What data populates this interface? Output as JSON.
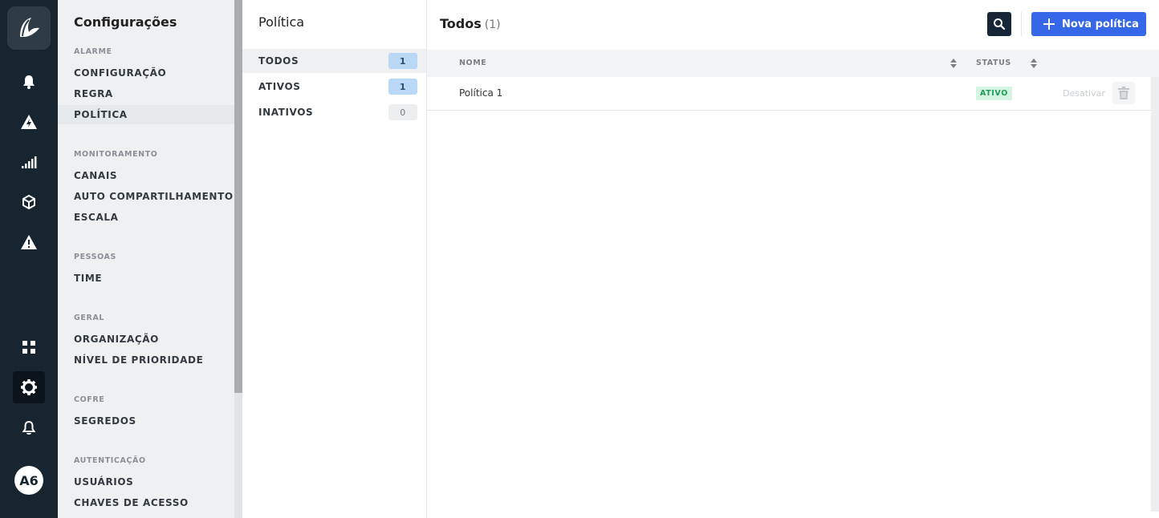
{
  "rail": {
    "avatar_initials": "A6",
    "icons": [
      "logo-icon",
      "bell-icon",
      "incident-bolt-icon",
      "signal-bars-icon",
      "cube-icon",
      "warning-icon",
      "apps-grid-icon",
      "gear-icon",
      "notification-bell-icon"
    ]
  },
  "settings": {
    "title": "Configurações",
    "sections": [
      {
        "label": "ALARME",
        "items": [
          "CONFIGURAÇÃO",
          "REGRA",
          "POLÍTICA"
        ]
      },
      {
        "label": "MONITORAMENTO",
        "items": [
          "CANAIS",
          "AUTO COMPARTILHAMENTO",
          "ESCALA"
        ]
      },
      {
        "label": "PESSOAS",
        "items": [
          "TIME"
        ]
      },
      {
        "label": "GERAL",
        "items": [
          "ORGANIZAÇÃO",
          "NÍVEL DE PRIORIDADE"
        ]
      },
      {
        "label": "COFRE",
        "items": [
          "SEGREDOS"
        ]
      },
      {
        "label": "AUTENTICAÇÃO",
        "items": [
          "USUÁRIOS",
          "CHAVES DE ACESSO"
        ]
      }
    ],
    "active_item": "POLÍTICA"
  },
  "policy": {
    "title": "Política",
    "filters": [
      {
        "label": "TODOS",
        "count": "1"
      },
      {
        "label": "ATIVOS",
        "count": "1"
      },
      {
        "label": "INATIVOS",
        "count": "0"
      }
    ]
  },
  "main": {
    "title": "Todos",
    "count": "(1)",
    "new_button_label": "Nova política",
    "columns": {
      "name": "NOME",
      "status": "STATUS"
    },
    "rows": [
      {
        "name": "Política 1",
        "status": "ATIVO",
        "action": "Desativar"
      }
    ]
  },
  "colors": {
    "rail_bg": "#162530",
    "accent_blue": "#3567e8",
    "active_green": "#1f9d55"
  }
}
